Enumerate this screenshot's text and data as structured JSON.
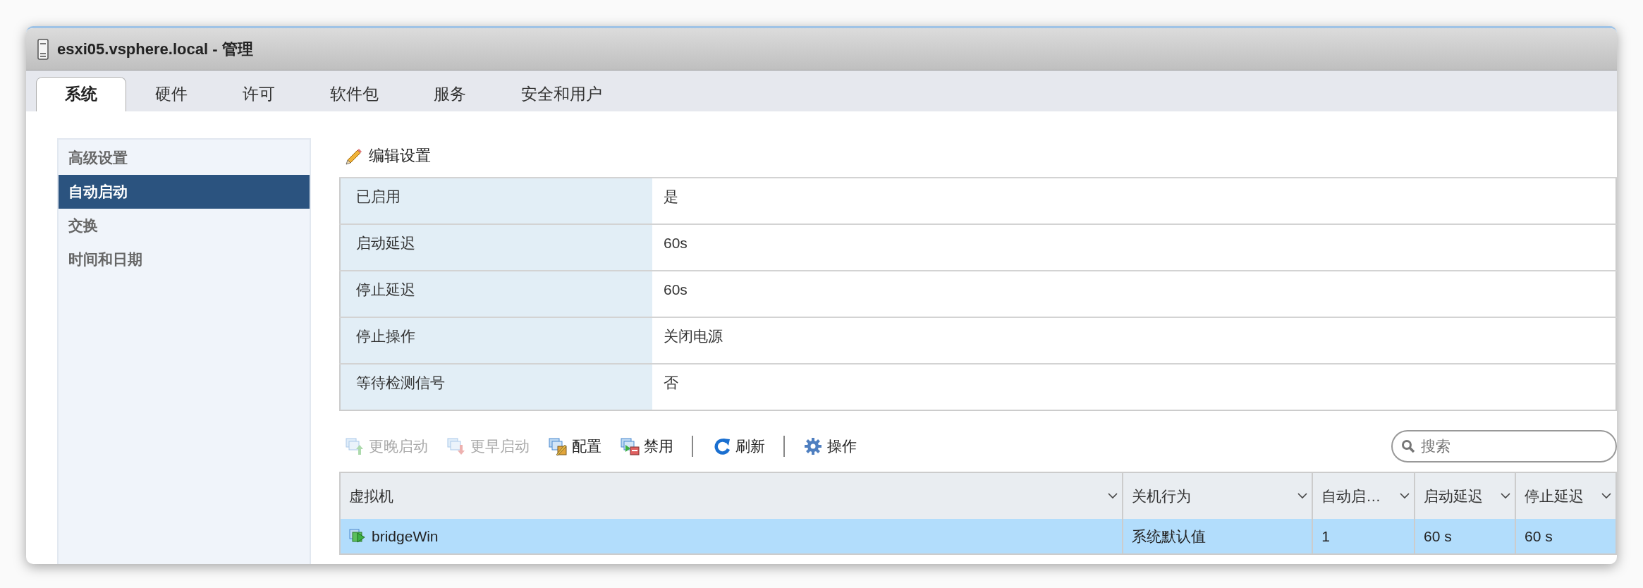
{
  "window": {
    "title": "esxi05.vsphere.local - 管理"
  },
  "tabs": [
    {
      "label": "系统",
      "selected": true
    },
    {
      "label": "硬件",
      "selected": false
    },
    {
      "label": "许可",
      "selected": false
    },
    {
      "label": "软件包",
      "selected": false
    },
    {
      "label": "服务",
      "selected": false
    },
    {
      "label": "安全和用户",
      "selected": false
    }
  ],
  "sidebar": {
    "items": [
      {
        "label": "高级设置",
        "selected": false
      },
      {
        "label": "自动启动",
        "selected": true
      },
      {
        "label": "交换",
        "selected": false
      },
      {
        "label": "时间和日期",
        "selected": false
      }
    ]
  },
  "edit_button": {
    "label": "编辑设置"
  },
  "settings": [
    {
      "label": "已启用",
      "value": "是"
    },
    {
      "label": "启动延迟",
      "value": "60s"
    },
    {
      "label": "停止延迟",
      "value": "60s"
    },
    {
      "label": "停止操作",
      "value": "关闭电源"
    },
    {
      "label": "等待检测信号",
      "value": "否"
    }
  ],
  "toolbar": {
    "items": [
      {
        "kind": "later",
        "label": "更晚启动",
        "disabled": true
      },
      {
        "kind": "earlier",
        "label": "更早启动",
        "disabled": true
      },
      {
        "kind": "configure",
        "label": "配置",
        "disabled": false
      },
      {
        "kind": "disable",
        "label": "禁用",
        "disabled": false
      },
      {
        "kind": "separator"
      },
      {
        "kind": "refresh",
        "label": "刷新",
        "disabled": false
      },
      {
        "kind": "separator"
      },
      {
        "kind": "actions",
        "label": "操作",
        "disabled": false
      }
    ],
    "search": {
      "placeholder": "搜索"
    }
  },
  "grid": {
    "columns": [
      "虚拟机",
      "关机行为",
      "自动启…",
      "启动延迟",
      "停止延迟"
    ],
    "rows": [
      {
        "cells": [
          "bridgeWin",
          "系统默认值",
          "1",
          "60 s",
          "60 s"
        ],
        "selected": true
      }
    ]
  }
}
